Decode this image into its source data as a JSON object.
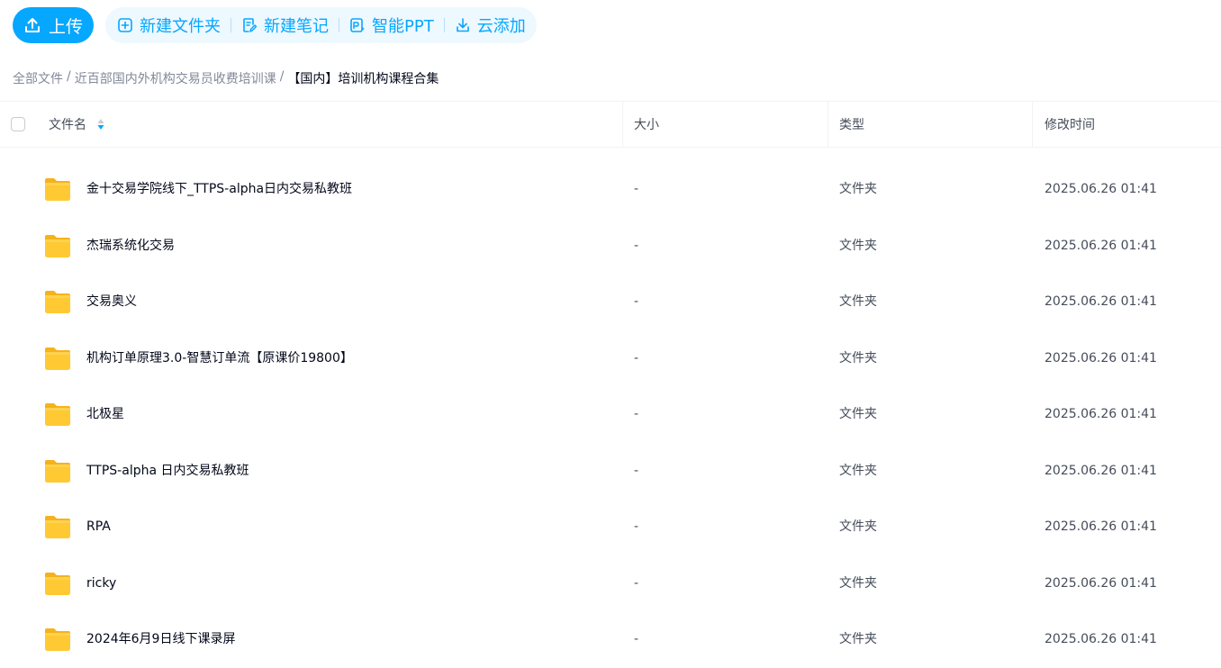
{
  "toolbar": {
    "upload_label": "上传",
    "actions": [
      {
        "label": "新建文件夹",
        "icon": "folder-plus-icon"
      },
      {
        "label": "新建笔记",
        "icon": "note-edit-icon"
      },
      {
        "label": "智能PPT",
        "icon": "ppt-ai-icon"
      },
      {
        "label": "云添加",
        "icon": "download-icon"
      }
    ],
    "accent_color": "#06a7ff"
  },
  "breadcrumb": {
    "items": [
      "全部文件",
      "近百部国内外机构交易员收费培训课"
    ],
    "separator": "/",
    "current": "【国内】培训机构课程合集"
  },
  "table": {
    "headers": {
      "name": "文件名",
      "size": "大小",
      "type": "类型",
      "modified": "修改时间"
    },
    "rows": [
      {
        "name": "金十交易学院线下_TTPS-alpha日内交易私教班",
        "size": "-",
        "type": "文件夹",
        "modified": "2025.06.26 01:41"
      },
      {
        "name": "杰瑞系统化交易",
        "size": "-",
        "type": "文件夹",
        "modified": "2025.06.26 01:41"
      },
      {
        "name": "交易奥义",
        "size": "-",
        "type": "文件夹",
        "modified": "2025.06.26 01:41"
      },
      {
        "name": "机构订单原理3.0-智慧订单流【原课价19800】",
        "size": "-",
        "type": "文件夹",
        "modified": "2025.06.26 01:41"
      },
      {
        "name": "北极星",
        "size": "-",
        "type": "文件夹",
        "modified": "2025.06.26 01:41"
      },
      {
        "name": "TTPS-alpha 日内交易私教班",
        "size": "-",
        "type": "文件夹",
        "modified": "2025.06.26 01:41"
      },
      {
        "name": "RPA",
        "size": "-",
        "type": "文件夹",
        "modified": "2025.06.26 01:41"
      },
      {
        "name": "ricky",
        "size": "-",
        "type": "文件夹",
        "modified": "2025.06.26 01:41"
      },
      {
        "name": "2024年6月9日线下课录屏",
        "size": "-",
        "type": "文件夹",
        "modified": "2025.06.26 01:41"
      }
    ]
  }
}
